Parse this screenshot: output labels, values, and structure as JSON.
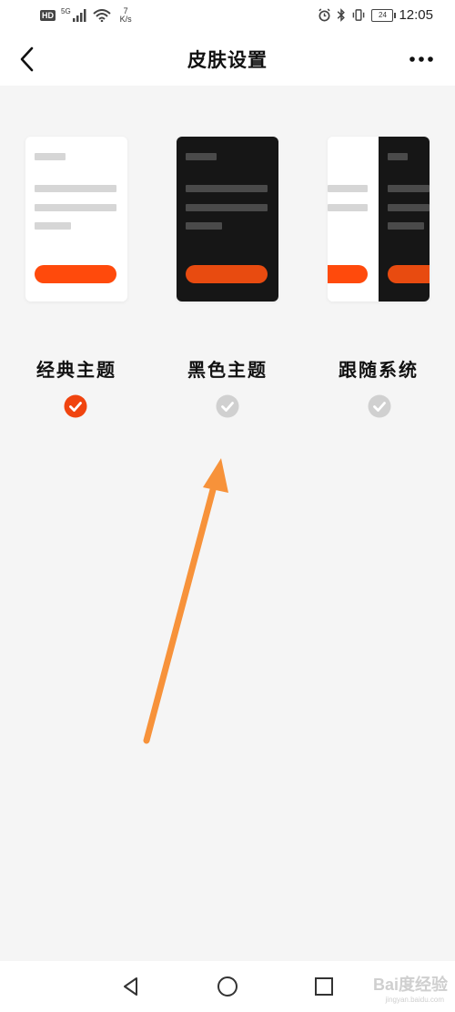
{
  "status_bar": {
    "hd": "HD",
    "network": "5G",
    "speed_value": "7",
    "speed_unit": "K/s",
    "battery": "24",
    "time": "12:05"
  },
  "header": {
    "title": "皮肤设置"
  },
  "themes": [
    {
      "label": "经典主题",
      "selected": true
    },
    {
      "label": "黑色主题",
      "selected": false
    },
    {
      "label": "跟随系统",
      "selected": false
    }
  ],
  "colors": {
    "accent": "#ff4a0c",
    "check_selected": "#f0440f",
    "check_unselected": "#d0d0d0",
    "annotation_arrow": "#f7923a"
  },
  "watermark": {
    "text": "Bai度经验",
    "sub": "jingyan.baidu.com"
  }
}
